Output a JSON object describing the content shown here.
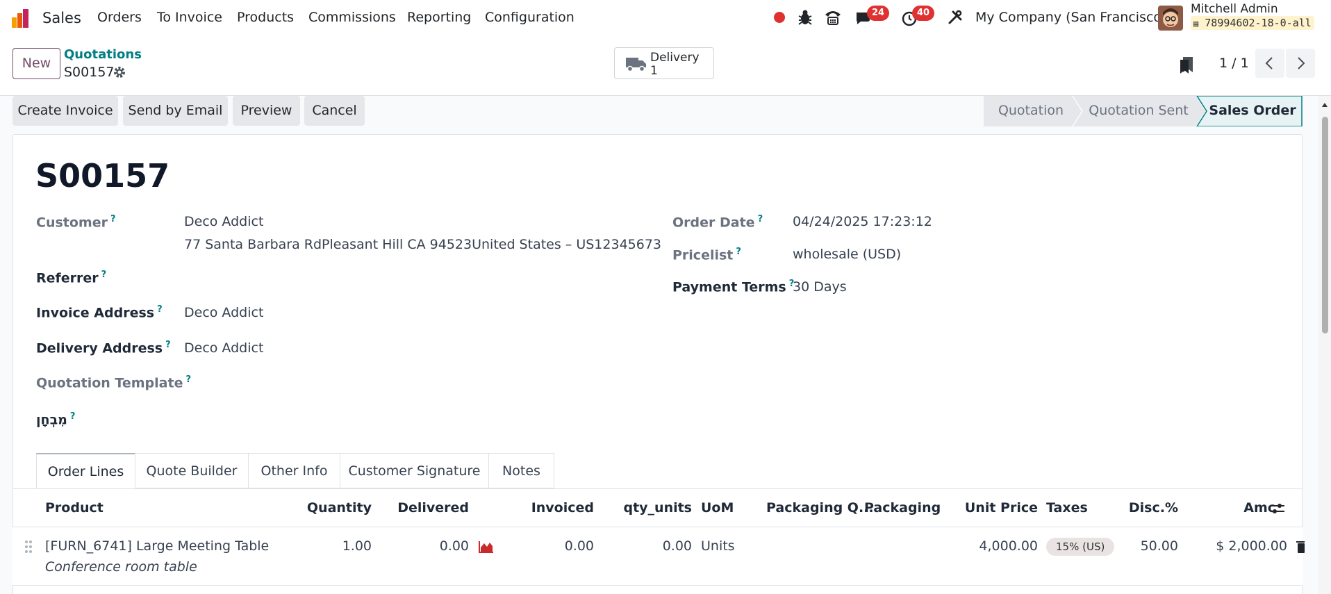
{
  "nav": {
    "app_name": "Sales",
    "menu": [
      "Orders",
      "To Invoice",
      "Products",
      "Commissions",
      "Reporting",
      "Configuration"
    ],
    "messages_count": "24",
    "activities_count": "40",
    "company": "My Company (San Francisco)",
    "user_name": "Mitchell Admin",
    "database": "78994602-18-0-all"
  },
  "control": {
    "new_label": "New",
    "breadcrumb_parent": "Quotations",
    "record_name": "S00157",
    "smart_delivery_label": "Delivery",
    "smart_delivery_count": "1",
    "pager": "1 / 1"
  },
  "actions": {
    "create_invoice": "Create Invoice",
    "send_email": "Send by Email",
    "preview": "Preview",
    "cancel": "Cancel"
  },
  "statusbar": [
    "Quotation",
    "Quotation Sent",
    "Sales Order"
  ],
  "form": {
    "title": "S00157",
    "customer_label": "Customer",
    "customer_value": "Deco Addict",
    "customer_address": "77 Santa Barbara RdPleasant Hill CA 94523United States – US12345673",
    "referrer_label": "Referrer",
    "invoice_address_label": "Invoice Address",
    "invoice_address_value": "Deco Addict",
    "delivery_address_label": "Delivery Address",
    "delivery_address_value": "Deco Addict",
    "quotation_template_label": "Quotation Template",
    "hebrew_label": "מִבְחָן",
    "order_date_label": "Order Date",
    "order_date_value": "04/24/2025 17:23:12",
    "pricelist_label": "Pricelist",
    "pricelist_value": "wholesale (USD)",
    "payment_terms_label": "Payment Terms",
    "payment_terms_value": "30 Days",
    "help_mark": "?"
  },
  "tabs": [
    "Order Lines",
    "Quote Builder",
    "Other Info",
    "Customer Signature",
    "Notes"
  ],
  "table": {
    "headers": [
      "Product",
      "Quantity",
      "Delivered",
      "Invoiced",
      "qty_units",
      "UoM",
      "Packaging Q...",
      "Packaging",
      "Unit Price",
      "Taxes",
      "Disc.%",
      "Amc"
    ],
    "rows": [
      {
        "product": "[FURN_6741] Large Meeting Table",
        "description": "Conference room table",
        "quantity": "1.00",
        "delivered": "0.00",
        "invoiced": "0.00",
        "qty_units": "0.00",
        "uom": "Units",
        "unit_price": "4,000.00",
        "taxes": "15% (US)",
        "discount": "50.00",
        "amount": "$ 2,000.00"
      }
    ]
  },
  "colors": {
    "brand": "#714b67",
    "link": "#017e84",
    "badge": "#e03131"
  }
}
